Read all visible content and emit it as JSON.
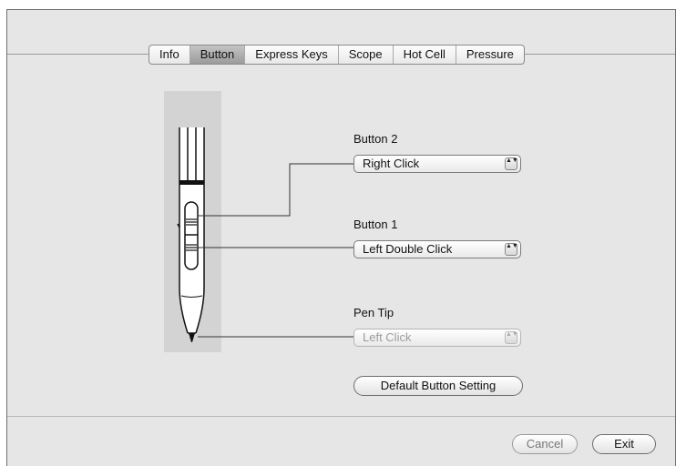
{
  "tabs": [
    {
      "label": "Info",
      "active": false
    },
    {
      "label": "Button",
      "active": true
    },
    {
      "label": "Express Keys",
      "active": false
    },
    {
      "label": "Scope",
      "active": false
    },
    {
      "label": "Hot Cell",
      "active": false
    },
    {
      "label": "Pressure",
      "active": false
    }
  ],
  "button2": {
    "label": "Button 2",
    "value": "Right Click"
  },
  "button1": {
    "label": "Button 1",
    "value": "Left Double Click"
  },
  "pen_tip": {
    "label": "Pen Tip",
    "value": "Left Click"
  },
  "default_button": "Default Button Setting",
  "footer": {
    "cancel": "Cancel",
    "exit": "Exit"
  },
  "popup_arrows_glyph": "▲▼"
}
